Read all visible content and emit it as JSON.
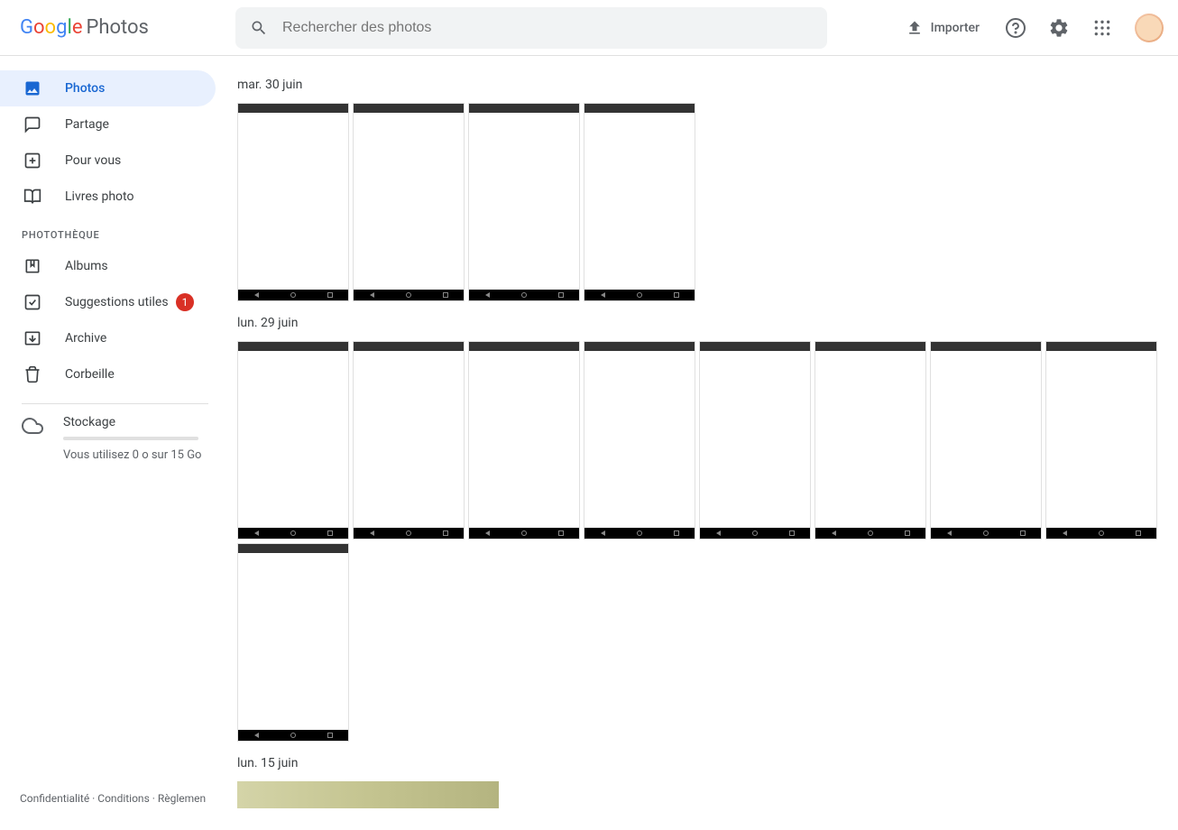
{
  "header": {
    "logo_product": "Photos",
    "search_placeholder": "Rechercher des photos",
    "import_label": "Importer"
  },
  "sidebar": {
    "main_nav": [
      {
        "label": "Photos",
        "icon": "image-icon",
        "active": true
      },
      {
        "label": "Partage",
        "icon": "chat-icon"
      },
      {
        "label": "Pour vous",
        "icon": "foryou-icon"
      },
      {
        "label": "Livres photo",
        "icon": "book-icon"
      }
    ],
    "section_label": "PHOTOTHÈQUE",
    "library_nav": [
      {
        "label": "Albums",
        "icon": "bookmark-icon"
      },
      {
        "label": "Suggestions utiles",
        "icon": "check-icon",
        "badge": "1"
      },
      {
        "label": "Archive",
        "icon": "archive-icon"
      },
      {
        "label": "Corbeille",
        "icon": "trash-icon"
      }
    ],
    "storage": {
      "title": "Stockage",
      "text": "Vous utilisez 0 o sur 15 Go"
    }
  },
  "footer": {
    "privacy": "Confidentialité",
    "terms": "Conditions",
    "rules": "Règlemen",
    "sep": " · "
  },
  "groups": [
    {
      "date": "mar. 30 juin",
      "count": 4
    },
    {
      "date": "lun. 29 juin",
      "count": 9
    },
    {
      "date": "lun. 15 juin",
      "count": 1
    }
  ]
}
